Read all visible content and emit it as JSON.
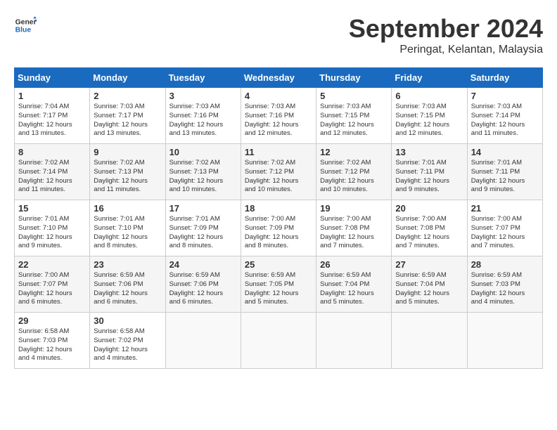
{
  "header": {
    "logo_line1": "General",
    "logo_line2": "Blue",
    "month_title": "September 2024",
    "subtitle": "Peringat, Kelantan, Malaysia"
  },
  "weekdays": [
    "Sunday",
    "Monday",
    "Tuesday",
    "Wednesday",
    "Thursday",
    "Friday",
    "Saturday"
  ],
  "weeks": [
    [
      {
        "day": "1",
        "info": "Sunrise: 7:04 AM\nSunset: 7:17 PM\nDaylight: 12 hours\nand 13 minutes."
      },
      {
        "day": "2",
        "info": "Sunrise: 7:03 AM\nSunset: 7:17 PM\nDaylight: 12 hours\nand 13 minutes."
      },
      {
        "day": "3",
        "info": "Sunrise: 7:03 AM\nSunset: 7:16 PM\nDaylight: 12 hours\nand 13 minutes."
      },
      {
        "day": "4",
        "info": "Sunrise: 7:03 AM\nSunset: 7:16 PM\nDaylight: 12 hours\nand 12 minutes."
      },
      {
        "day": "5",
        "info": "Sunrise: 7:03 AM\nSunset: 7:15 PM\nDaylight: 12 hours\nand 12 minutes."
      },
      {
        "day": "6",
        "info": "Sunrise: 7:03 AM\nSunset: 7:15 PM\nDaylight: 12 hours\nand 12 minutes."
      },
      {
        "day": "7",
        "info": "Sunrise: 7:03 AM\nSunset: 7:14 PM\nDaylight: 12 hours\nand 11 minutes."
      }
    ],
    [
      {
        "day": "8",
        "info": "Sunrise: 7:02 AM\nSunset: 7:14 PM\nDaylight: 12 hours\nand 11 minutes."
      },
      {
        "day": "9",
        "info": "Sunrise: 7:02 AM\nSunset: 7:13 PM\nDaylight: 12 hours\nand 11 minutes."
      },
      {
        "day": "10",
        "info": "Sunrise: 7:02 AM\nSunset: 7:13 PM\nDaylight: 12 hours\nand 10 minutes."
      },
      {
        "day": "11",
        "info": "Sunrise: 7:02 AM\nSunset: 7:12 PM\nDaylight: 12 hours\nand 10 minutes."
      },
      {
        "day": "12",
        "info": "Sunrise: 7:02 AM\nSunset: 7:12 PM\nDaylight: 12 hours\nand 10 minutes."
      },
      {
        "day": "13",
        "info": "Sunrise: 7:01 AM\nSunset: 7:11 PM\nDaylight: 12 hours\nand 9 minutes."
      },
      {
        "day": "14",
        "info": "Sunrise: 7:01 AM\nSunset: 7:11 PM\nDaylight: 12 hours\nand 9 minutes."
      }
    ],
    [
      {
        "day": "15",
        "info": "Sunrise: 7:01 AM\nSunset: 7:10 PM\nDaylight: 12 hours\nand 9 minutes."
      },
      {
        "day": "16",
        "info": "Sunrise: 7:01 AM\nSunset: 7:10 PM\nDaylight: 12 hours\nand 8 minutes."
      },
      {
        "day": "17",
        "info": "Sunrise: 7:01 AM\nSunset: 7:09 PM\nDaylight: 12 hours\nand 8 minutes."
      },
      {
        "day": "18",
        "info": "Sunrise: 7:00 AM\nSunset: 7:09 PM\nDaylight: 12 hours\nand 8 minutes."
      },
      {
        "day": "19",
        "info": "Sunrise: 7:00 AM\nSunset: 7:08 PM\nDaylight: 12 hours\nand 7 minutes."
      },
      {
        "day": "20",
        "info": "Sunrise: 7:00 AM\nSunset: 7:08 PM\nDaylight: 12 hours\nand 7 minutes."
      },
      {
        "day": "21",
        "info": "Sunrise: 7:00 AM\nSunset: 7:07 PM\nDaylight: 12 hours\nand 7 minutes."
      }
    ],
    [
      {
        "day": "22",
        "info": "Sunrise: 7:00 AM\nSunset: 7:07 PM\nDaylight: 12 hours\nand 6 minutes."
      },
      {
        "day": "23",
        "info": "Sunrise: 6:59 AM\nSunset: 7:06 PM\nDaylight: 12 hours\nand 6 minutes."
      },
      {
        "day": "24",
        "info": "Sunrise: 6:59 AM\nSunset: 7:06 PM\nDaylight: 12 hours\nand 6 minutes."
      },
      {
        "day": "25",
        "info": "Sunrise: 6:59 AM\nSunset: 7:05 PM\nDaylight: 12 hours\nand 5 minutes."
      },
      {
        "day": "26",
        "info": "Sunrise: 6:59 AM\nSunset: 7:04 PM\nDaylight: 12 hours\nand 5 minutes."
      },
      {
        "day": "27",
        "info": "Sunrise: 6:59 AM\nSunset: 7:04 PM\nDaylight: 12 hours\nand 5 minutes."
      },
      {
        "day": "28",
        "info": "Sunrise: 6:59 AM\nSunset: 7:03 PM\nDaylight: 12 hours\nand 4 minutes."
      }
    ],
    [
      {
        "day": "29",
        "info": "Sunrise: 6:58 AM\nSunset: 7:03 PM\nDaylight: 12 hours\nand 4 minutes."
      },
      {
        "day": "30",
        "info": "Sunrise: 6:58 AM\nSunset: 7:02 PM\nDaylight: 12 hours\nand 4 minutes."
      },
      {
        "day": "",
        "info": ""
      },
      {
        "day": "",
        "info": ""
      },
      {
        "day": "",
        "info": ""
      },
      {
        "day": "",
        "info": ""
      },
      {
        "day": "",
        "info": ""
      }
    ]
  ]
}
